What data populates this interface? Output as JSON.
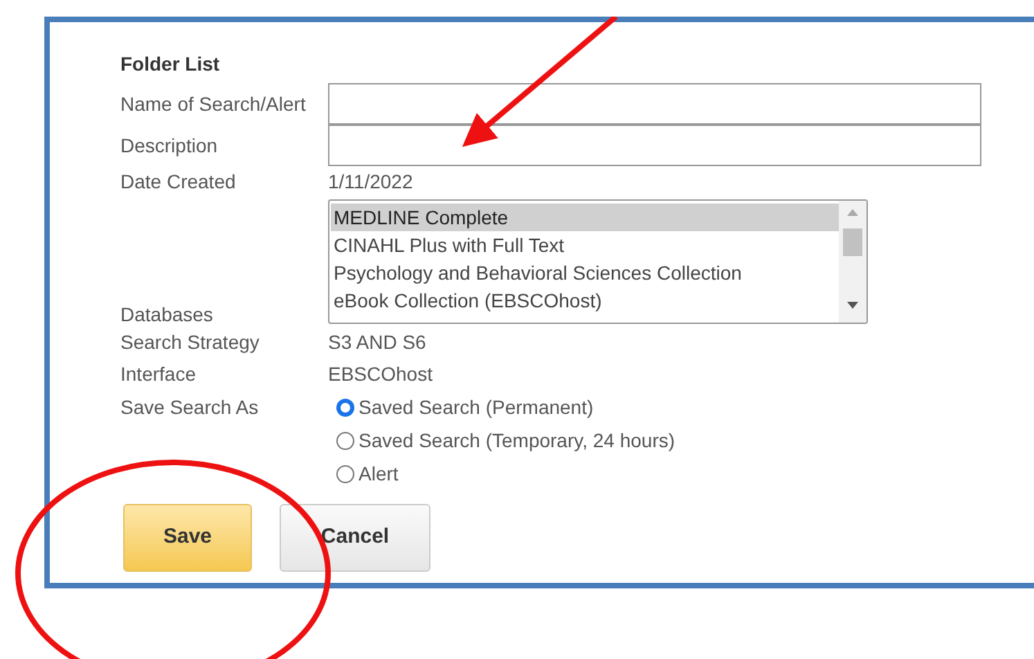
{
  "heading": "Folder List",
  "fields": [
    {
      "kind": "input",
      "label": "Name of Search/Alert"
    },
    {
      "kind": "input",
      "label": "Description"
    },
    {
      "kind": "text",
      "label": "Date Created",
      "value": "1/11/2022"
    },
    {
      "kind": "listbox",
      "label": "Databases",
      "options": [
        {
          "label": "MEDLINE Complete",
          "selected": true
        },
        {
          "label": "CINAHL Plus with Full Text",
          "selected": false
        },
        {
          "label": "Psychology and Behavioral Sciences Collection",
          "selected": false
        },
        {
          "label": "eBook Collection (EBSCOhost)",
          "selected": false
        }
      ]
    },
    {
      "kind": "text",
      "label": "Search Strategy",
      "value": "S3 AND S6"
    },
    {
      "kind": "text",
      "label": "Interface",
      "value": "EBSCOhost"
    },
    {
      "kind": "radio",
      "label": "Save Search As",
      "options": [
        {
          "label": "Saved Search (Permanent)",
          "selected": true
        },
        {
          "label": "Saved Search (Temporary, 24 hours)",
          "selected": false
        },
        {
          "label": "Alert",
          "selected": false
        }
      ]
    }
  ],
  "buttons": [
    {
      "label": "Save",
      "kind": "primary"
    },
    {
      "label": "Cancel",
      "kind": "secondary"
    }
  ]
}
